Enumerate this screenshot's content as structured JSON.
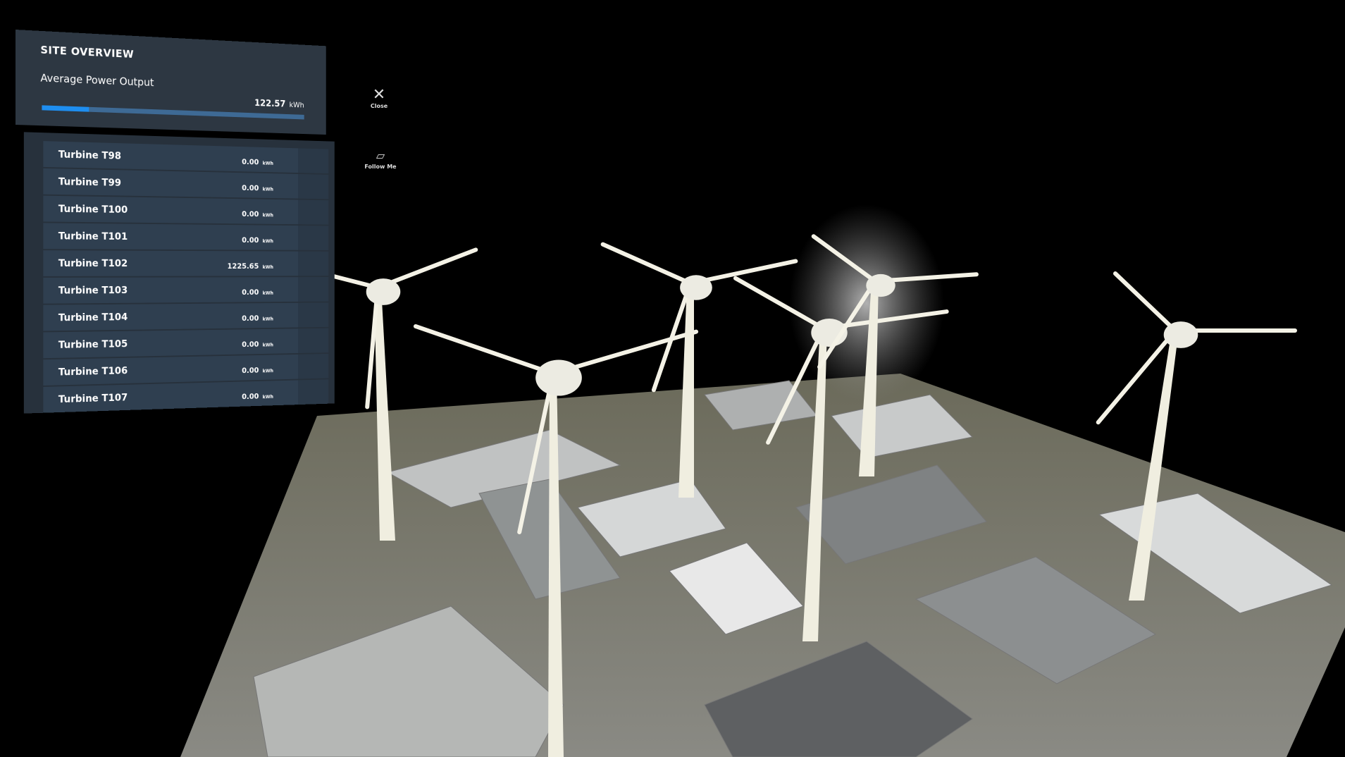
{
  "panel": {
    "title": "SITE OVERVIEW",
    "average": {
      "label": "Average Power Output",
      "value": "122.57",
      "unit": "kWh",
      "bar_fraction": 0.17
    },
    "turbines": [
      {
        "name": "Turbine T98",
        "value": "0.00",
        "unit": "kWh"
      },
      {
        "name": "Turbine T99",
        "value": "0.00",
        "unit": "kWh"
      },
      {
        "name": "Turbine T100",
        "value": "0.00",
        "unit": "kWh"
      },
      {
        "name": "Turbine T101",
        "value": "0.00",
        "unit": "kWh"
      },
      {
        "name": "Turbine T102",
        "value": "1225.65",
        "unit": "kWh"
      },
      {
        "name": "Turbine T103",
        "value": "0.00",
        "unit": "kWh"
      },
      {
        "name": "Turbine T104",
        "value": "0.00",
        "unit": "kWh"
      },
      {
        "name": "Turbine T105",
        "value": "0.00",
        "unit": "kWh"
      },
      {
        "name": "Turbine T106",
        "value": "0.00",
        "unit": "kWh"
      },
      {
        "name": "Turbine T107",
        "value": "0.00",
        "unit": "kWh"
      }
    ]
  },
  "buttons": {
    "close": "Close",
    "follow": "Follow Me"
  },
  "colors": {
    "accent": "#1e8ef0",
    "panel": "#2d3742",
    "row": "#2f3f50"
  }
}
